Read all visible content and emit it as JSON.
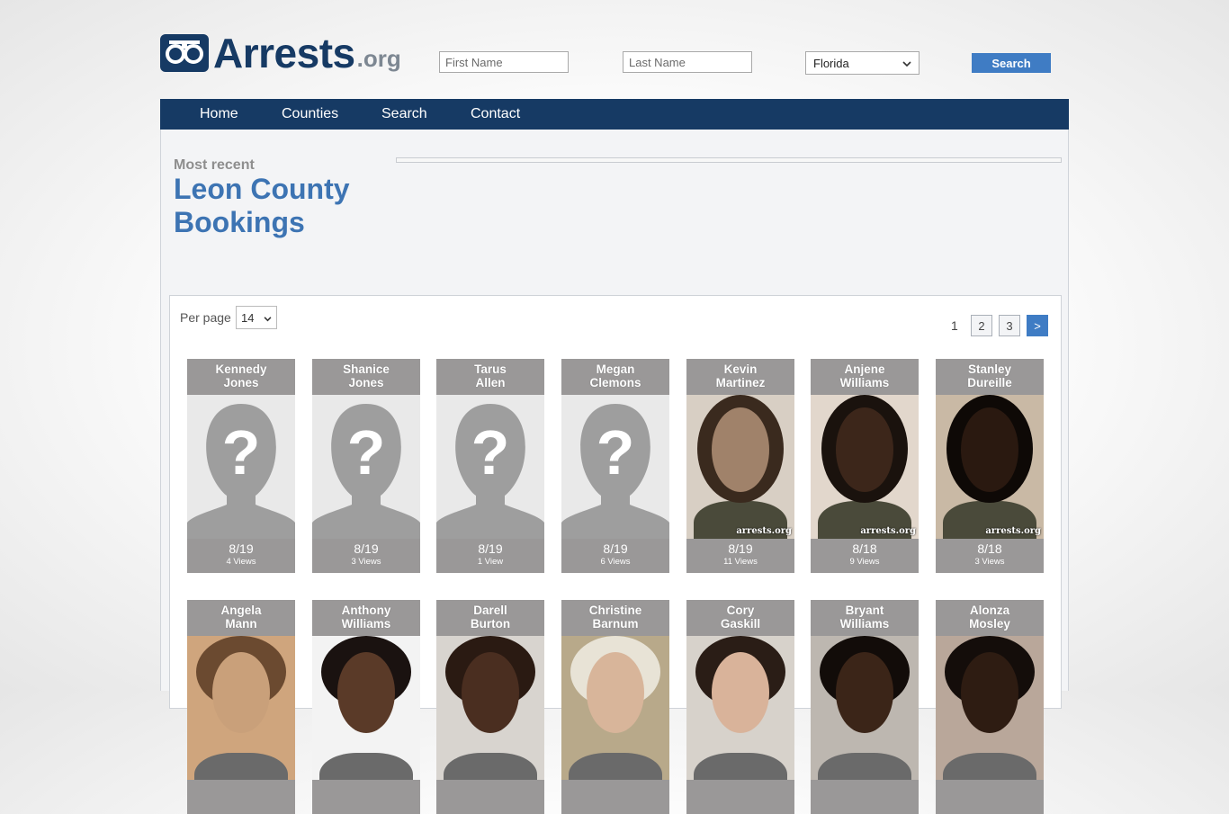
{
  "header": {
    "logo_main": "Arrests",
    "logo_tld": ".org",
    "first_name_placeholder": "First Name",
    "last_name_placeholder": "Last Name",
    "state_selected": "Florida",
    "search_label": "Search"
  },
  "nav": {
    "items": [
      "Home",
      "Counties",
      "Search",
      "Contact"
    ]
  },
  "intro": {
    "most_recent": "Most recent",
    "title": "Leon County Bookings"
  },
  "listing": {
    "per_page_label": "Per page",
    "per_page_value": "14",
    "pagination": {
      "current": "1",
      "pages": [
        "2",
        "3"
      ],
      "next": ">"
    }
  },
  "bookings_row1": [
    {
      "first": "Kennedy",
      "last": "Jones",
      "date": "8/19",
      "views": "4 Views",
      "photo": "placeholder"
    },
    {
      "first": "Shanice",
      "last": "Jones",
      "date": "8/19",
      "views": "3 Views",
      "photo": "placeholder"
    },
    {
      "first": "Tarus",
      "last": "Allen",
      "date": "8/19",
      "views": "1 View",
      "photo": "placeholder"
    },
    {
      "first": "Megan",
      "last": "Clemons",
      "date": "8/19",
      "views": "6 Views",
      "photo": "placeholder"
    },
    {
      "first": "Kevin",
      "last": "Martinez",
      "date": "8/19",
      "views": "11 Views",
      "photo": "mugshot"
    },
    {
      "first": "Anjene",
      "last": "Williams",
      "date": "8/18",
      "views": "9 Views",
      "photo": "mugshot"
    },
    {
      "first": "Stanley",
      "last": "Dureille",
      "date": "8/18",
      "views": "3 Views",
      "photo": "mugshot"
    }
  ],
  "bookings_row2": [
    {
      "first": "Angela",
      "last": "Mann",
      "photo": "mugshot"
    },
    {
      "first": "Anthony",
      "last": "Williams",
      "photo": "mugshot"
    },
    {
      "first": "Darell",
      "last": "Burton",
      "photo": "mugshot"
    },
    {
      "first": "Christine",
      "last": "Barnum",
      "photo": "mugshot"
    },
    {
      "first": "Cory",
      "last": "Gaskill",
      "photo": "mugshot"
    },
    {
      "first": "Bryant",
      "last": "Williams",
      "photo": "mugshot"
    },
    {
      "first": "Alonza",
      "last": "Mosley",
      "photo": "mugshot"
    }
  ],
  "watermark": "arrests.org",
  "colors": {
    "brand_navy": "#163a64",
    "accent_blue": "#3f7cc4",
    "title_blue": "#3d74b3",
    "card_gray": "#9a9898"
  }
}
